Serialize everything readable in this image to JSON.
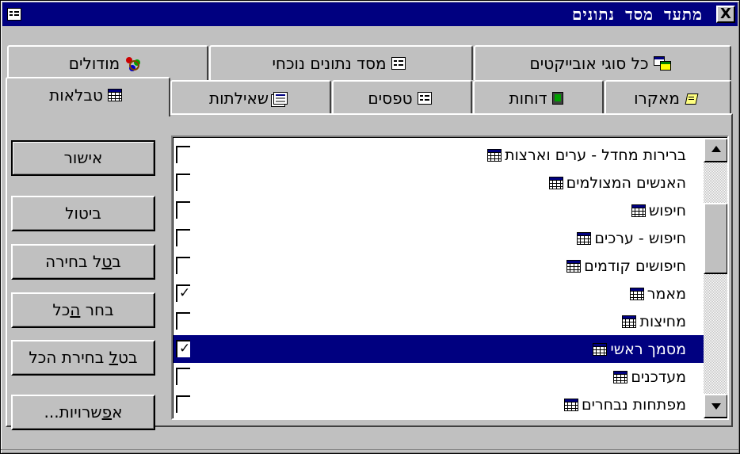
{
  "window": {
    "title": "מתעד מסד נתונים",
    "close_glyph": "X"
  },
  "tabs_row1": [
    {
      "label": "כל סוגי אובייקטים",
      "icon": "all-object-types-icon"
    },
    {
      "label": "מסד נתונים נוכחי",
      "icon": "form-icon"
    },
    {
      "label": "מודולים",
      "icon": "modules-icon"
    }
  ],
  "tabs_row2": [
    {
      "label": "מאקרו",
      "icon": "macro-icon"
    },
    {
      "label": "דוחות",
      "icon": "report-icon"
    },
    {
      "label": "טפסים",
      "icon": "form-icon"
    },
    {
      "label": "שאילתות",
      "icon": "query-icon"
    },
    {
      "label": "טבלאות",
      "icon": "table-icon",
      "active": true
    }
  ],
  "list": {
    "items": [
      {
        "label": "ברירות מחדל - ערים וארצות",
        "checked": false,
        "selected": false
      },
      {
        "label": "האנשים המצולמים",
        "checked": false,
        "selected": false
      },
      {
        "label": "חיפוש",
        "checked": false,
        "selected": false
      },
      {
        "label": "חיפוש - ערכים",
        "checked": false,
        "selected": false
      },
      {
        "label": "חיפושים קודמים",
        "checked": false,
        "selected": false
      },
      {
        "label": "מאמר",
        "checked": true,
        "selected": false
      },
      {
        "label": "מחיצות",
        "checked": false,
        "selected": false
      },
      {
        "label": "מסמך ראשי",
        "checked": true,
        "selected": true
      },
      {
        "label": "מעדכנים",
        "checked": false,
        "selected": false
      },
      {
        "label": "מפתחות נבחרים",
        "checked": false,
        "selected": false
      }
    ],
    "check_glyph": "✓"
  },
  "buttons": {
    "ok": {
      "label": "אישור"
    },
    "cancel": {
      "label": "ביטול"
    },
    "deselect": {
      "pre": "ב",
      "accel": "ט",
      "post": "ל בחירה"
    },
    "select_all": {
      "pre": "בחר ",
      "accel": "ה",
      "post": "כל"
    },
    "deselect_all": {
      "pre": "בט",
      "accel": "ל",
      "post": " בחירת הכל"
    },
    "options": {
      "pre": "א",
      "accel": "פ",
      "post": "שרויות..."
    }
  },
  "colors": {
    "titlebar": "#000080",
    "face": "#c0c0c0",
    "selection": "#000080"
  }
}
